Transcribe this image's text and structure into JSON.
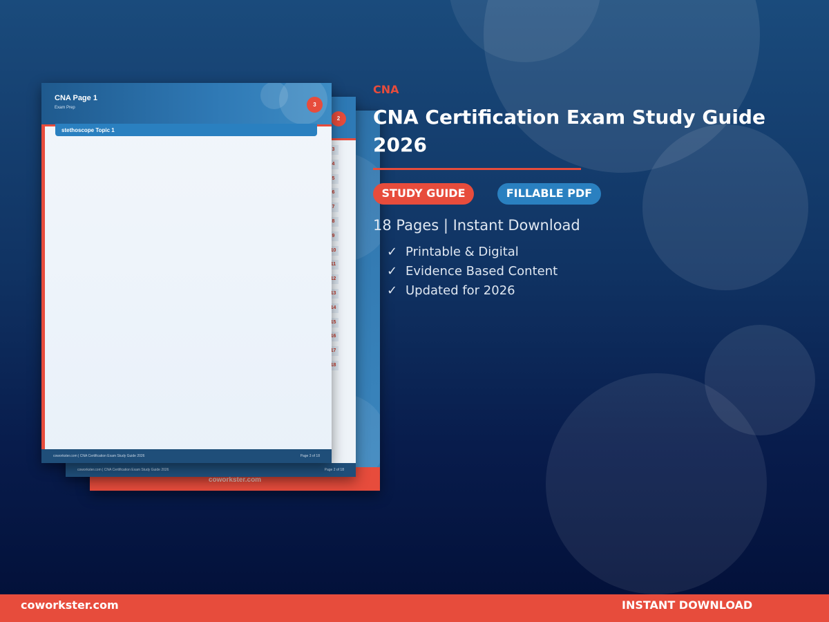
{
  "category": "CNA",
  "title": "CNA Certification Exam Study Guide 2026",
  "badges": {
    "primary": "STUDY GUIDE",
    "secondary": "FILLABLE PDF"
  },
  "summary": "18 Pages | Instant Download",
  "features": [
    {
      "check": "✓",
      "text": "Printable & Digital"
    },
    {
      "check": "✓",
      "text": "Evidence Based Content"
    },
    {
      "check": "✓",
      "text": "Updated for 2026"
    }
  ],
  "preview": {
    "page_front": {
      "title": "CNA Page 1",
      "subtitle": "Exam Prep",
      "badge": "3",
      "topic": "stethoscope  Topic 1",
      "footer_left": "coworkster.com  |  CNA Certification Exam Study Guide 2026",
      "footer_right": "Page 3 of 18"
    },
    "page_middle": {
      "badge": "2",
      "numbers": [
        "3",
        "4",
        "5",
        "6",
        "7",
        "8",
        "9",
        "10",
        "11",
        "12",
        "13",
        "14",
        "15",
        "16",
        "17",
        "18"
      ],
      "footer_left": "coworkster.com  |  CNA Certification Exam Study Guide 2026",
      "footer_right": "Page 2 of 18"
    },
    "page_back": {
      "brand": "coworkster.com"
    }
  },
  "footer": {
    "site": "coworkster.com",
    "cta": "INSTANT DOWNLOAD"
  },
  "colors": {
    "accent": "#e74c3c",
    "blue": "#2a80c0",
    "navy": "#0c2a57"
  }
}
